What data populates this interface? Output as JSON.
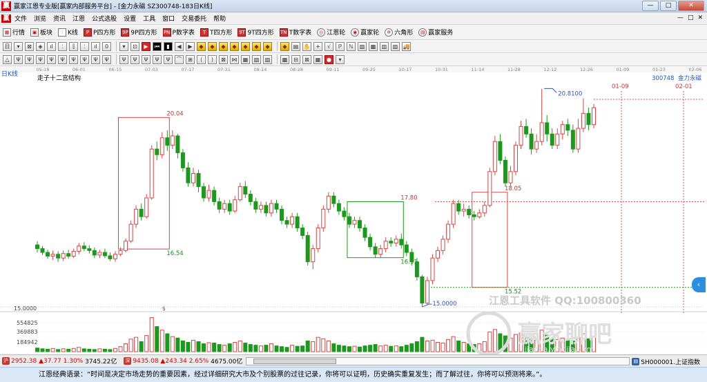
{
  "window": {
    "title": "赢家江恩专业版[赢家内部服务平台] - [金力永磁  SZ300748-183日K线]",
    "app_icon": "赢",
    "buttons": [
      "—",
      "□",
      "✕"
    ]
  },
  "menu": {
    "items": [
      "文件",
      "浏览",
      "资讯",
      "江恩",
      "公式选股",
      "设置",
      "工具",
      "窗口",
      "交易委托",
      "帮助"
    ],
    "mdi_buttons": [
      "—",
      "□",
      "✕"
    ]
  },
  "toolbar1": {
    "items": [
      {
        "icon": "grid-icon",
        "glyph": "▦",
        "label": "行情"
      },
      {
        "icon": "blocks-icon",
        "glyph": "▣",
        "label": "板块"
      },
      {
        "icon": "kline-icon",
        "glyph": "⫶",
        "label": "K线"
      },
      {
        "icon": "p-square-icon",
        "glyph": "P",
        "label": "P四方形"
      },
      {
        "icon": "9p-square-icon",
        "glyph": "9P",
        "label": "9P四方形"
      },
      {
        "icon": "pn-table-icon",
        "glyph": "PN",
        "label": "P数字表"
      },
      {
        "icon": "t-square-icon",
        "glyph": "T",
        "label": "T四方形"
      },
      {
        "icon": "9t-square-icon",
        "glyph": "9T",
        "label": "9T四方形"
      },
      {
        "icon": "tn-table-icon",
        "glyph": "TN",
        "label": "T数字表"
      },
      {
        "icon": "gann-wheel-icon",
        "glyph": "◎",
        "label": "江恩轮"
      },
      {
        "icon": "winner-wheel-icon",
        "glyph": "◉",
        "label": "赢家轮"
      },
      {
        "icon": "hexagon-icon",
        "glyph": "✡",
        "label": "六角形"
      },
      {
        "icon": "winner-service-icon",
        "glyph": "▤",
        "label": "赢家服务"
      }
    ]
  },
  "toolbar2": {
    "glyphs": [
      "日",
      "▾",
      "⊠",
      "◈",
      "ıl",
      "⫶",
      "⫿",
      "⫶",
      "ıl",
      "0",
      "▾",
      "⊡",
      "▶",
      "⏮",
      "▮",
      "◀",
      "▶",
      "◆",
      "◆",
      "◆",
      "◆",
      "◆",
      "◆",
      "◆",
      "◆",
      "▤",
      "✋",
      "+",
      "√",
      "ℙ",
      "ℕ",
      "▧",
      "▩",
      "▥",
      "▨",
      "🚚"
    ]
  },
  "toolbar3": {
    "glyphs": [
      "△",
      "Ψ",
      "Ψ",
      "Ψ",
      "Ψ",
      "Ψ",
      "Ψ",
      "Ψ",
      "Ψ",
      "Ψ",
      "Ψ",
      "Ψ",
      "Ψ",
      "Ψ",
      "Ψ",
      "⌒",
      "⊞",
      "⟨",
      "⟩",
      "⊠",
      "⋈",
      "▦",
      "▧",
      "▨",
      "▩",
      "⊟",
      "⊠",
      "▦",
      "●",
      "▾"
    ]
  },
  "chart_data": {
    "type": "candlestick",
    "period_label": "日K线",
    "title": "走子十二宫结构",
    "stock_code": "300748",
    "stock_name": "金力永磁",
    "date_ticks": [
      "05-18",
      "06-01",
      "06-15",
      "07-03",
      "07-17",
      "07-31",
      "08-14",
      "08-28",
      "09-11",
      "09-25",
      "10-17",
      "10-31",
      "11-14",
      "11-28",
      "12-12",
      "12-26",
      "01-09",
      "01-23",
      "02-06"
    ],
    "price_labels": {
      "high": "20.8100",
      "low": "15.0000",
      "box1_top": "20.04",
      "box1_bottom": "16.54",
      "box2_top": "17.80",
      "box2_bottom": "16.31",
      "box3_top": "18.05",
      "box3_bottom": "15.52"
    },
    "future_dates": [
      "01-09",
      "02-01"
    ],
    "volume_axis": {
      "ticks": [
        "15.0000",
        "554825",
        "369883",
        "184942"
      ]
    },
    "volume_marker": "$",
    "ylim": [
      14.8,
      21.0
    ],
    "candles": [
      [
        16.65,
        16.55,
        16.75,
        16.45
      ],
      [
        16.55,
        16.45,
        16.62,
        16.38
      ],
      [
        16.45,
        16.35,
        16.52,
        16.28
      ],
      [
        16.35,
        16.4,
        16.5,
        16.25
      ],
      [
        16.4,
        16.3,
        16.48,
        16.2
      ],
      [
        16.3,
        16.42,
        16.5,
        16.22
      ],
      [
        16.42,
        16.35,
        16.52,
        16.28
      ],
      [
        16.35,
        16.48,
        16.55,
        16.3
      ],
      [
        16.48,
        16.62,
        16.7,
        16.4
      ],
      [
        16.62,
        16.55,
        16.72,
        16.48
      ],
      [
        16.55,
        16.5,
        16.64,
        16.42
      ],
      [
        16.5,
        16.38,
        16.58,
        16.3
      ],
      [
        16.38,
        16.45,
        16.52,
        16.3
      ],
      [
        16.45,
        16.36,
        16.55,
        16.3
      ],
      [
        16.36,
        16.28,
        16.45,
        16.22
      ],
      [
        16.28,
        16.4,
        16.48,
        16.2
      ],
      [
        16.4,
        16.5,
        16.58,
        16.35
      ],
      [
        16.5,
        16.75,
        16.82,
        16.45
      ],
      [
        16.75,
        17.2,
        17.3,
        16.7
      ],
      [
        17.2,
        17.6,
        17.7,
        17.1
      ],
      [
        17.6,
        17.4,
        17.75,
        17.3
      ],
      [
        17.4,
        17.9,
        18.0,
        17.35
      ],
      [
        17.9,
        19.2,
        19.3,
        17.85
      ],
      [
        19.2,
        19.05,
        19.4,
        18.9
      ],
      [
        19.05,
        19.5,
        19.65,
        18.95
      ],
      [
        19.5,
        19.3,
        19.7,
        19.15
      ],
      [
        19.3,
        19.55,
        19.7,
        19.2
      ],
      [
        19.55,
        19.1,
        19.6,
        18.95
      ],
      [
        19.1,
        18.7,
        19.2,
        18.6
      ],
      [
        18.7,
        18.3,
        18.85,
        18.2
      ],
      [
        18.3,
        18.55,
        18.7,
        18.2
      ],
      [
        18.55,
        18.2,
        18.65,
        18.05
      ],
      [
        18.2,
        17.9,
        18.3,
        17.8
      ],
      [
        17.9,
        18.1,
        18.25,
        17.8
      ],
      [
        18.1,
        17.8,
        18.2,
        17.7
      ],
      [
        17.8,
        17.6,
        17.9,
        17.5
      ],
      [
        17.6,
        17.75,
        17.85,
        17.5
      ],
      [
        17.75,
        17.55,
        17.85,
        17.45
      ],
      [
        17.55,
        17.85,
        17.95,
        17.5
      ],
      [
        17.85,
        18.2,
        18.3,
        17.8
      ],
      [
        18.2,
        18.0,
        18.35,
        17.9
      ],
      [
        18.0,
        17.8,
        18.1,
        17.7
      ],
      [
        17.8,
        17.6,
        17.9,
        17.5
      ],
      [
        17.6,
        17.7,
        17.8,
        17.5
      ],
      [
        17.7,
        17.5,
        17.8,
        17.4
      ],
      [
        17.5,
        17.75,
        17.85,
        17.4
      ],
      [
        17.75,
        17.6,
        17.85,
        17.5
      ],
      [
        17.6,
        17.3,
        17.7,
        17.2
      ],
      [
        17.3,
        17.2,
        17.4,
        17.1
      ],
      [
        17.2,
        17.4,
        17.5,
        17.1
      ],
      [
        17.4,
        17.1,
        17.5,
        17.0
      ],
      [
        17.1,
        16.9,
        17.2,
        16.8
      ],
      [
        16.9,
        16.2,
        17.0,
        16.1
      ],
      [
        16.2,
        16.55,
        16.65,
        16.0
      ],
      [
        16.55,
        17.1,
        17.2,
        16.45
      ],
      [
        17.1,
        17.6,
        17.7,
        17.0
      ],
      [
        17.6,
        17.95,
        18.05,
        17.5
      ],
      [
        17.95,
        17.75,
        18.05,
        17.65
      ],
      [
        17.75,
        17.55,
        17.85,
        17.45
      ],
      [
        17.55,
        17.4,
        17.65,
        17.3
      ],
      [
        17.4,
        17.2,
        17.5,
        17.1
      ],
      [
        17.2,
        17.3,
        17.4,
        17.1
      ],
      [
        17.3,
        17.1,
        17.4,
        17.0
      ],
      [
        17.1,
        16.85,
        17.2,
        16.75
      ],
      [
        16.85,
        16.6,
        16.95,
        16.5
      ],
      [
        16.6,
        16.4,
        16.7,
        16.3
      ],
      [
        16.4,
        16.55,
        16.65,
        16.3
      ],
      [
        16.55,
        16.75,
        16.85,
        16.45
      ],
      [
        16.75,
        16.7,
        16.85,
        16.6
      ],
      [
        16.7,
        16.8,
        16.9,
        16.6
      ],
      [
        16.8,
        16.65,
        16.95,
        16.55
      ],
      [
        16.65,
        16.45,
        16.75,
        16.35
      ],
      [
        16.45,
        16.2,
        16.55,
        16.1
      ],
      [
        16.2,
        15.8,
        16.3,
        15.7
      ],
      [
        15.8,
        15.1,
        15.85,
        15.0
      ],
      [
        15.1,
        15.7,
        15.8,
        15.05
      ],
      [
        15.7,
        16.3,
        16.4,
        15.6
      ],
      [
        16.3,
        16.5,
        16.6,
        16.2
      ],
      [
        16.5,
        16.8,
        16.9,
        16.4
      ],
      [
        16.8,
        17.2,
        17.3,
        16.7
      ],
      [
        17.2,
        17.75,
        17.85,
        17.1
      ],
      [
        17.75,
        17.55,
        17.85,
        17.45
      ],
      [
        17.55,
        17.6,
        17.75,
        17.4
      ],
      [
        17.6,
        17.45,
        17.7,
        17.35
      ],
      [
        17.45,
        17.4,
        17.55,
        17.3
      ],
      [
        17.4,
        17.5,
        17.6,
        17.35
      ],
      [
        17.5,
        17.7,
        17.8,
        17.4
      ],
      [
        17.7,
        18.6,
        18.7,
        17.65
      ],
      [
        18.6,
        19.4,
        19.55,
        18.5
      ],
      [
        19.4,
        18.9,
        19.6,
        18.8
      ],
      [
        18.9,
        18.3,
        19.0,
        18.2
      ],
      [
        18.3,
        18.6,
        18.75,
        18.2
      ],
      [
        18.6,
        19.3,
        19.4,
        18.5
      ],
      [
        19.3,
        19.8,
        19.95,
        19.2
      ],
      [
        19.8,
        19.6,
        20.0,
        19.5
      ],
      [
        19.6,
        19.2,
        19.75,
        19.05
      ],
      [
        19.2,
        19.4,
        19.6,
        19.1
      ],
      [
        19.4,
        19.9,
        20.8,
        19.3
      ],
      [
        19.9,
        19.6,
        20.1,
        19.4
      ],
      [
        19.6,
        19.3,
        19.75,
        19.2
      ],
      [
        19.3,
        19.6,
        19.75,
        19.2
      ],
      [
        19.6,
        19.85,
        19.95,
        19.45
      ],
      [
        19.85,
        19.7,
        20.0,
        19.55
      ],
      [
        19.7,
        19.2,
        19.85,
        19.1
      ],
      [
        19.2,
        19.75,
        20.0,
        19.1
      ],
      [
        19.75,
        20.15,
        20.55,
        19.65
      ],
      [
        20.15,
        19.85,
        20.3,
        19.7
      ],
      [
        19.85,
        20.3,
        20.4,
        19.75
      ]
    ],
    "volumes": [
      0.1,
      0.08,
      0.07,
      0.09,
      0.06,
      0.08,
      0.07,
      0.09,
      0.12,
      0.08,
      0.07,
      0.06,
      0.08,
      0.07,
      0.06,
      0.09,
      0.14,
      0.22,
      0.35,
      0.4,
      0.28,
      0.45,
      0.95,
      0.7,
      0.6,
      0.5,
      0.42,
      0.38,
      0.3,
      0.26,
      0.32,
      0.28,
      0.22,
      0.25,
      0.24,
      0.2,
      0.18,
      0.22,
      0.26,
      0.3,
      0.24,
      0.2,
      0.18,
      0.16,
      0.18,
      0.22,
      0.16,
      0.14,
      0.12,
      0.18,
      0.15,
      0.16,
      0.3,
      0.28,
      0.4,
      0.36,
      0.3,
      0.22,
      0.18,
      0.16,
      0.14,
      0.15,
      0.13,
      0.16,
      0.18,
      0.2,
      0.16,
      0.18,
      0.15,
      0.16,
      0.14,
      0.18,
      0.22,
      0.28,
      0.4,
      0.3,
      0.32,
      0.26,
      0.24,
      0.34,
      0.42,
      0.3,
      0.26,
      0.22,
      0.2,
      0.22,
      0.28,
      0.55,
      0.62,
      0.5,
      0.44,
      0.38,
      0.48,
      0.52,
      0.4,
      0.36,
      0.32,
      0.6,
      0.46,
      0.36,
      0.34,
      0.38,
      0.32,
      0.3,
      0.4,
      0.5,
      0.36,
      0.42
    ]
  },
  "watermark": {
    "line1": "江恩工具软件  QQ:100800360",
    "line2": "赢家聊吧",
    "line3": "jiaoba.yingjia.com"
  },
  "statusbar": {
    "index1": "2952.38",
    "index1_change": "▲37.77 1.30%",
    "index1_amount": "3745.22亿",
    "index2": "9435.08",
    "index2_change": "▲243.34 2.65%",
    "index2_amount": "4675.00亿",
    "right_label": "SH000001.上证指数"
  },
  "quote": "江恩经典语录：“时间是决定市场走势的重要因素，经过详细研究大市及个别股票的过往记录，你将可以证明，历史确实重复发生；而了解过往，你将可以预测将来。”。"
}
